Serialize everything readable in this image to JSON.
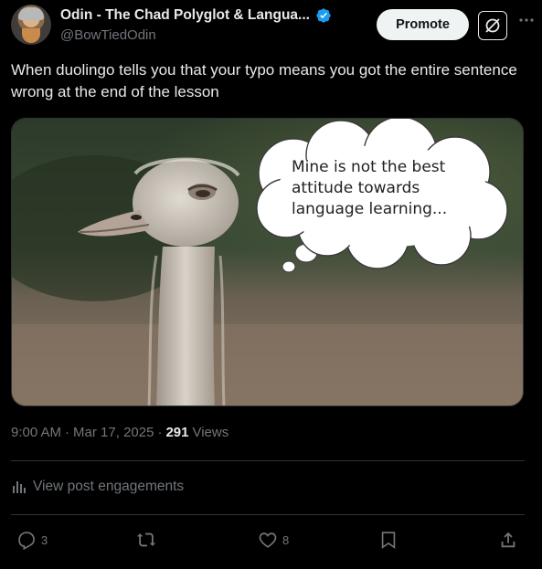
{
  "author": {
    "name": "Odin - The Chad Polyglot & Langua...",
    "handle": "@BowTiedOdin",
    "verified": true
  },
  "header": {
    "promote_label": "Promote",
    "more_icon": "more-icon",
    "grok_icon": "grok-icon"
  },
  "post": {
    "text": "When duolingo tells you that your typo means you got the entire sentence wrong at the end of the lesson",
    "image": {
      "speech_bubble_text": "Mine is not the best attitude towards language learning..."
    }
  },
  "meta": {
    "time": "9:00 AM",
    "separator": "·",
    "date": "Mar 17, 2025",
    "views_count": "291",
    "views_label": "Views"
  },
  "engagements": {
    "label": "View post engagements"
  },
  "actions": {
    "reply_count": "3",
    "repost_count": "",
    "like_count": "8"
  },
  "colors": {
    "background": "#000000",
    "text": "#e7e9ea",
    "muted": "#71767b",
    "verified": "#1d9bf0",
    "divider": "#2f3336"
  }
}
